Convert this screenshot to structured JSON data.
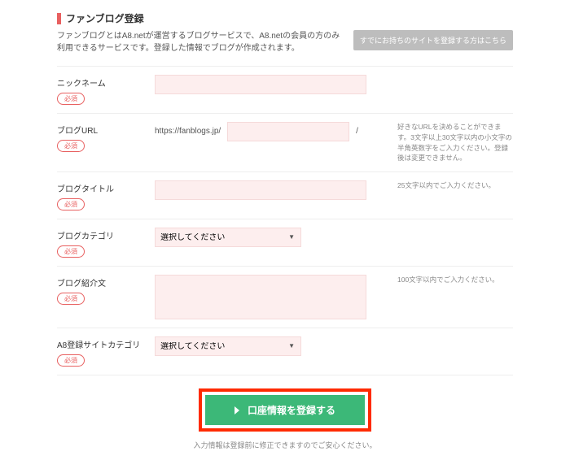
{
  "header": {
    "title": "ファンブログ登録",
    "intro": "ファンブログとはA8.netが運営するブログサービスで、A8.netの会員の方のみ利用できるサービスです。登録した情報でブログが作成されます。",
    "existing_button": "すでにお持ちのサイトを登録する方はこちら"
  },
  "labels": {
    "required": "必須"
  },
  "fields": {
    "nickname": {
      "label": "ニックネーム"
    },
    "blog_url": {
      "label": "ブログURL",
      "prefix": "https://fanblogs.jp/",
      "suffix": "/",
      "hint": "好きなURLを決めることができます。3文字以上30文字以内の小文字の半角英数字をご入力ください。登録後は変更できません。"
    },
    "blog_title": {
      "label": "ブログタイトル",
      "hint": "25文字以内でご入力ください。"
    },
    "blog_category": {
      "label": "ブログカテゴリ",
      "placeholder": "選択してください"
    },
    "blog_intro": {
      "label": "ブログ紹介文",
      "hint": "100文字以内でご入力ください。"
    },
    "a8_category": {
      "label": "A8登録サイトカテゴリ",
      "placeholder": "選択してください"
    }
  },
  "submit": {
    "label": "口座情報を登録する"
  },
  "footer": {
    "note": "入力情報は登録前に修正できますのでご安心ください。"
  }
}
